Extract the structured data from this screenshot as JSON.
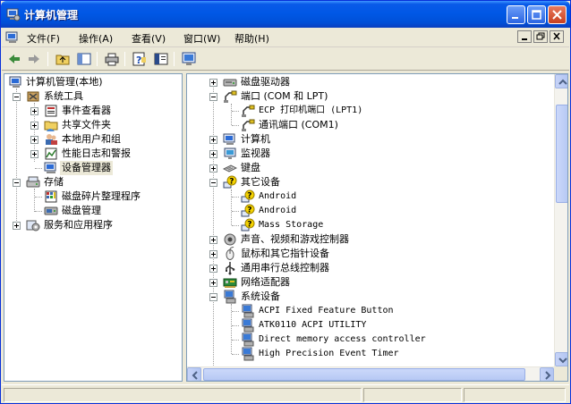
{
  "window": {
    "title": "计算机管理"
  },
  "menubar": {
    "items": [
      "文件(F)",
      "操作(A)",
      "查看(V)",
      "窗口(W)",
      "帮助(H)"
    ]
  },
  "toolbar": {
    "buttons": [
      "back-icon",
      "forward-icon",
      "up-folder-icon",
      "show-hide-tree-icon",
      "print-icon",
      "help-icon",
      "properties-icon",
      "scan-hardware-icon"
    ]
  },
  "left_tree": {
    "root": "计算机管理(本地)",
    "system_tools": "系统工具",
    "system_tools_children": [
      "事件查看器",
      "共享文件夹",
      "本地用户和组",
      "性能日志和警报",
      "设备管理器"
    ],
    "storage": "存储",
    "storage_children": [
      "磁盘碎片整理程序",
      "磁盘管理"
    ],
    "services": "服务和应用程序",
    "selected": "设备管理器"
  },
  "right_tree": {
    "rows": [
      {
        "label": "磁盘驱动器",
        "level": 0,
        "state": "collapsed",
        "icon": "disk-drive-icon"
      },
      {
        "label": "端口 (COM 和 LPT)",
        "level": 0,
        "state": "expanded",
        "icon": "port-icon"
      },
      {
        "label": "ECP 打印机端口 (LPT1)",
        "level": 1,
        "state": "leaf",
        "icon": "port-icon"
      },
      {
        "label": "通讯端口 (COM1)",
        "level": 1,
        "state": "leaf",
        "icon": "port-icon"
      },
      {
        "label": "计算机",
        "level": 0,
        "state": "collapsed",
        "icon": "computer-icon"
      },
      {
        "label": "监视器",
        "level": 0,
        "state": "collapsed",
        "icon": "monitor-icon"
      },
      {
        "label": "键盘",
        "level": 0,
        "state": "collapsed",
        "icon": "keyboard-icon"
      },
      {
        "label": "其它设备",
        "level": 0,
        "state": "expanded",
        "icon": "unknown-device-icon"
      },
      {
        "label": "Android",
        "level": 1,
        "state": "leaf",
        "icon": "unknown-device-icon"
      },
      {
        "label": "Android",
        "level": 1,
        "state": "leaf",
        "icon": "unknown-device-icon"
      },
      {
        "label": "Mass Storage",
        "level": 1,
        "state": "leaf",
        "icon": "unknown-device-icon"
      },
      {
        "label": "声音、视频和游戏控制器",
        "level": 0,
        "state": "collapsed",
        "icon": "sound-icon"
      },
      {
        "label": "鼠标和其它指针设备",
        "level": 0,
        "state": "collapsed",
        "icon": "mouse-icon"
      },
      {
        "label": "通用串行总线控制器",
        "level": 0,
        "state": "collapsed",
        "icon": "usb-icon"
      },
      {
        "label": "网络适配器",
        "level": 0,
        "state": "collapsed",
        "icon": "network-adapter-icon"
      },
      {
        "label": "系统设备",
        "level": 0,
        "state": "expanded",
        "icon": "system-device-icon"
      },
      {
        "label": "ACPI Fixed Feature Button",
        "level": 1,
        "state": "leaf",
        "icon": "system-device-icon"
      },
      {
        "label": "ATK0110 ACPI UTILITY",
        "level": 1,
        "state": "leaf",
        "icon": "system-device-icon"
      },
      {
        "label": "Direct memory access controller",
        "level": 1,
        "state": "leaf",
        "icon": "system-device-icon"
      },
      {
        "label": "High Precision Event Timer",
        "level": 1,
        "state": "leaf",
        "icon": "system-device-icon"
      }
    ]
  },
  "colors": {
    "titlebar": "#0058e6",
    "window_bg": "#ece9d8",
    "pane_border": "#7f9db9",
    "warning_yellow": "#f5d300"
  }
}
